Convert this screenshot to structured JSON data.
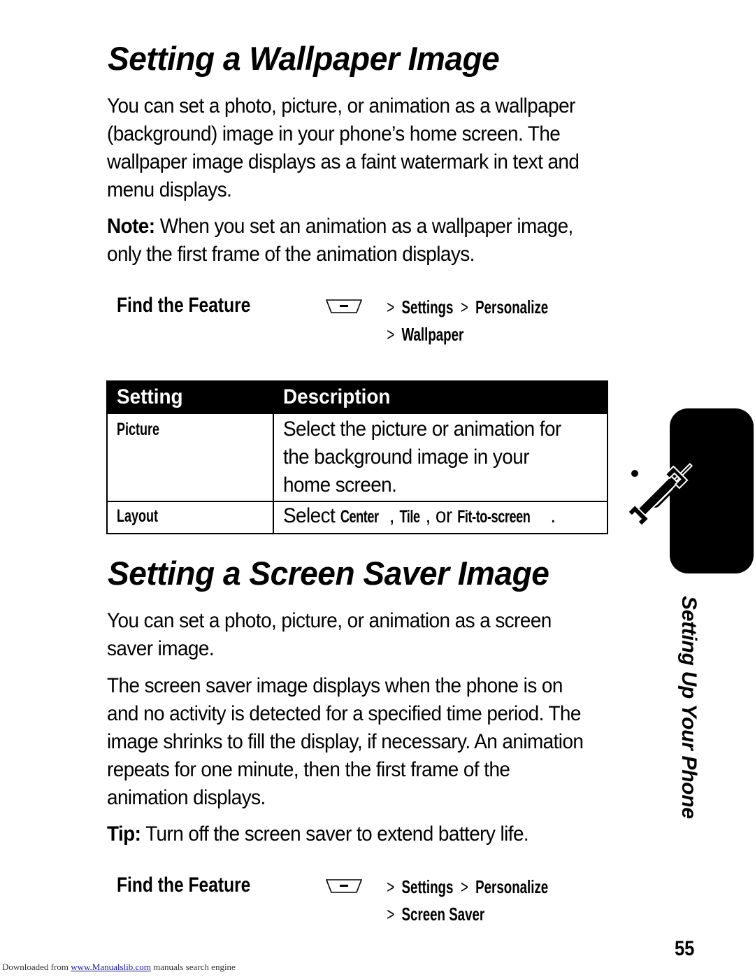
{
  "section1": {
    "title": "Setting a Wallpaper Image",
    "paragraph_lines": [
      "You can set a photo, picture, or animation as a wallpaper",
      "(background) image in your phone’s home screen. The",
      "wallpaper image displays as a faint watermark in text and",
      "menu displays."
    ],
    "note_label": "Note:",
    "note_lines": [
      " When you set an animation as a wallpaper image,",
      "only the first frame of the animation displays."
    ],
    "find_feature": {
      "label": "Find the Feature",
      "icon": "menu-key-icon",
      "path": [
        "Settings",
        "Personalize",
        "Wallpaper"
      ]
    },
    "table": {
      "headers": [
        "Setting",
        "Description"
      ],
      "rows": [
        {
          "setting": "Picture",
          "description_lines": [
            "Select the picture or animation for",
            "the background image in your",
            "home screen."
          ]
        },
        {
          "setting": "Layout",
          "description_prefix": "Select ",
          "options": [
            "Center",
            "Tile",
            "Fit-to-screen"
          ],
          "sep1": ", ",
          "sep2": ", or ",
          "suffix": "."
        }
      ]
    }
  },
  "section2": {
    "title": "Setting a Screen Saver Image",
    "paragraph1_lines": [
      "You can set a photo, picture, or animation as a screen",
      "saver image."
    ],
    "paragraph2_lines": [
      "The screen saver image displays when the phone is on",
      "and no activity is detected for a specified time period. The",
      "image shrinks to fill the display, if necessary. An animation",
      "repeats for one minute, then the first frame of the",
      "animation displays."
    ],
    "tip_label": "Tip:",
    "tip_text": " Turn off the screen saver to extend battery life.",
    "find_feature": {
      "label": "Find the Feature",
      "icon": "menu-key-icon",
      "path": [
        "Settings",
        "Personalize",
        "Screen Saver"
      ]
    }
  },
  "side_tab": {
    "icon": "wrench-screwdriver-icon",
    "label": "Setting Up Your Phone"
  },
  "page_number": "55",
  "footer": {
    "prefix": "Downloaded from ",
    "link": "www.Manualslib.com",
    "suffix": "  manuals search engine"
  },
  "gt": ">"
}
